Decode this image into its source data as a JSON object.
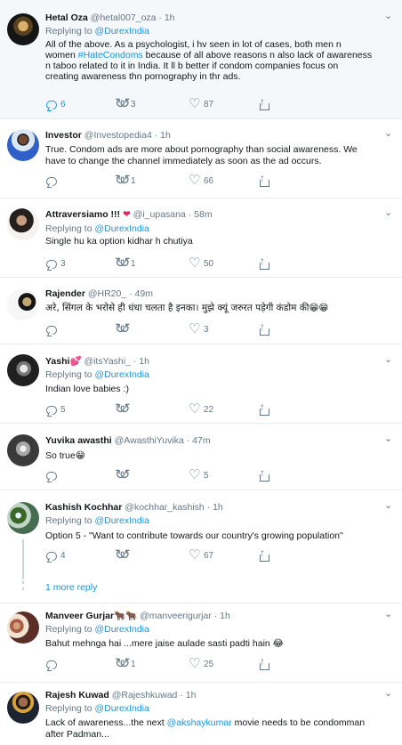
{
  "tweets": [
    {
      "name": "Hetal Oza",
      "handle": "@hetal007_oza",
      "dot": "·",
      "time": "1h",
      "replying": "Replying to",
      "mention": "@DurexIndia",
      "body1a": "All of the above. As a psychologist, i hv seen in lot of cases, both men n",
      "body2a": "women ",
      "tag": "#HateCondoms",
      "body2b": " because of all above reasons n also lack of awareness",
      "body3": "n taboo related to it in India. It ll b better if condom companies focus on",
      "body4": "creating awareness thn pornography in thr ads.",
      "replies": "6",
      "retweets": "3",
      "likes": "87"
    },
    {
      "name": "Investor",
      "handle": "@Investopedia4",
      "dot": "·",
      "time": "1h",
      "body1": "True. Condom ads are more about pornography than social awareness. We",
      "body2": "have to change the channel immediately as soon as the ad occurs.",
      "retweets": "1",
      "likes": "66"
    },
    {
      "name": "Attraversiamo !!!",
      "heart": "❤",
      "handle": "@i_upasana",
      "dot": "·",
      "time": "58m",
      "replying": "Replying to",
      "mention": "@DurexIndia",
      "body1": "Single hu ka option kidhar h chutiya",
      "replies": "3",
      "retweets": "1",
      "likes": "50"
    },
    {
      "name": "Rajender",
      "handle": "@HR20_",
      "dot": "·",
      "time": "49m",
      "body1": "अरे, सिंगल के भरोसे ही धंधा चलता है इनका। मुझे क्यूं जरुरत पड़ेगी कंडोम की😁😁",
      "likes": "3"
    },
    {
      "name": "Yashi",
      "heart": "💕",
      "handle": "@itsYashi_",
      "dot": "·",
      "time": "1h",
      "replying": "Replying to",
      "mention": "@DurexIndia",
      "body1": "Indian love babies :)",
      "replies": "5",
      "likes": "22"
    },
    {
      "name": "Yuvika awasthi",
      "handle": "@AwasthiYuvika",
      "dot": "·",
      "time": "47m",
      "body1": "So true😁",
      "likes": "5"
    },
    {
      "name": "Kashish Kochhar",
      "handle": "@kochhar_kashish",
      "dot": "·",
      "time": "1h",
      "replying": "Replying to",
      "mention": "@DurexIndia",
      "body1": "Option 5 - \"Want to contribute towards our country's growing population\"",
      "replies": "4",
      "likes": "67"
    },
    {
      "more": "1 more reply"
    },
    {
      "name": "Manveer Gurjar",
      "emoji": "🐂🐂",
      "handle": "@manveerigurjar",
      "dot": "·",
      "time": "1h",
      "replying": "Replying to",
      "mention": "@DurexIndia",
      "body1": "Bahut mehnga hai ...mere jaise aulade sasti padti hain 😂",
      "retweets": "1",
      "likes": "25"
    },
    {
      "name": "Rajesh Kuwad",
      "handle": "@Rajeshkuwad",
      "dot": "·",
      "time": "1h",
      "replying": "Replying to",
      "mention": "@DurexIndia",
      "body1a": "Lack of awareness...the next ",
      "mention2": "@akshaykumar",
      "body1b": " movie needs to be condomman",
      "body2": "after Padman..."
    }
  ],
  "icons": [
    "reply-icon",
    "retweet-icon",
    "heart-icon",
    "share-icon",
    "chevron-down-icon"
  ],
  "colors": {
    "text": "#14171a",
    "muted": "#657786",
    "link": "#1b95e0",
    "highlight_bg": "#f5f8fa",
    "border": "#e6ecf0"
  }
}
